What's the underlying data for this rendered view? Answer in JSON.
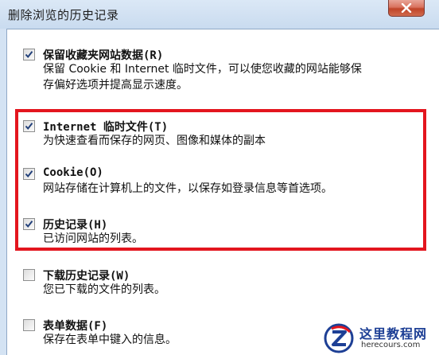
{
  "window": {
    "title": "删除浏览的历史记录"
  },
  "items": [
    {
      "label": "保留收藏夹网站数据(R)",
      "checked": true,
      "desc": [
        "保留 Cookie 和 Internet 临时文件，可以使您收藏的网站能够保",
        "存偏好选项并提高显示速度。"
      ]
    },
    {
      "label": "Internet 临时文件(T)",
      "checked": true,
      "desc": [
        "为快速查看而保存的网页、图像和媒体的副本"
      ]
    },
    {
      "label": "Cookie(O)",
      "checked": true,
      "desc": [
        "网站存储在计算机上的文件，以保存如登录信息等首选项。"
      ]
    },
    {
      "label": "历史记录(H)",
      "checked": true,
      "desc": [
        "已访问网站的列表。"
      ]
    },
    {
      "label": "下载历史记录(W)",
      "checked": false,
      "desc": [
        "您已下载的文件的列表。"
      ]
    },
    {
      "label": "表单数据(F)",
      "checked": false,
      "desc": [
        "保存在表单中键入的信息。"
      ]
    }
  ],
  "watermark": {
    "title": "这里教程网",
    "url": "herecours.com"
  },
  "colors": {
    "highlight": "#e3151e",
    "check": "#22407a"
  }
}
